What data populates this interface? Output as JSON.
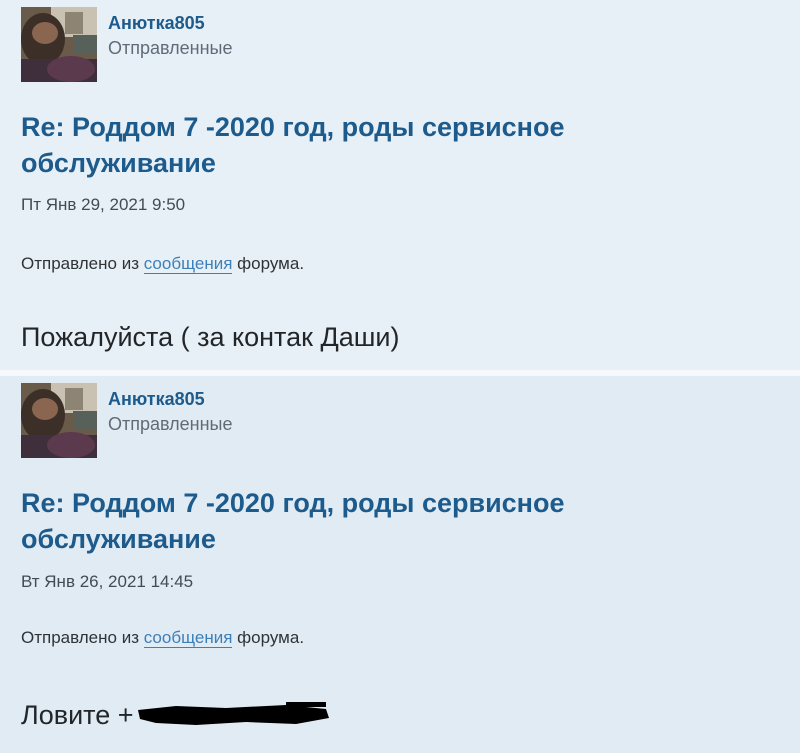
{
  "posts": [
    {
      "author": "Анютка805",
      "folder": "Отправленные",
      "title": "Re: Роддом 7 -2020 год, роды сервисное обслуживание",
      "date": "Пт Янв 29, 2021 9:50",
      "sent_prefix": "Отправлено из",
      "sent_link": "сообщения",
      "sent_suffix": "форума.",
      "body": "Пожалуйста ( за контак Даши)"
    },
    {
      "author": "Анютка805",
      "folder": "Отправленные",
      "title": "Re: Роддом 7 -2020 год, роды сервисное обслуживание",
      "date": "Вт Янв 26, 2021 14:45",
      "sent_prefix": "Отправлено из",
      "sent_link": "сообщения",
      "sent_suffix": "форума.",
      "body": "Ловите +"
    }
  ],
  "colors": {
    "link": "#1d5b8c",
    "accent_link": "#3d7fb8",
    "post_bg_1": "#e8f0f7",
    "post_bg_2": "#e1ebf4"
  }
}
